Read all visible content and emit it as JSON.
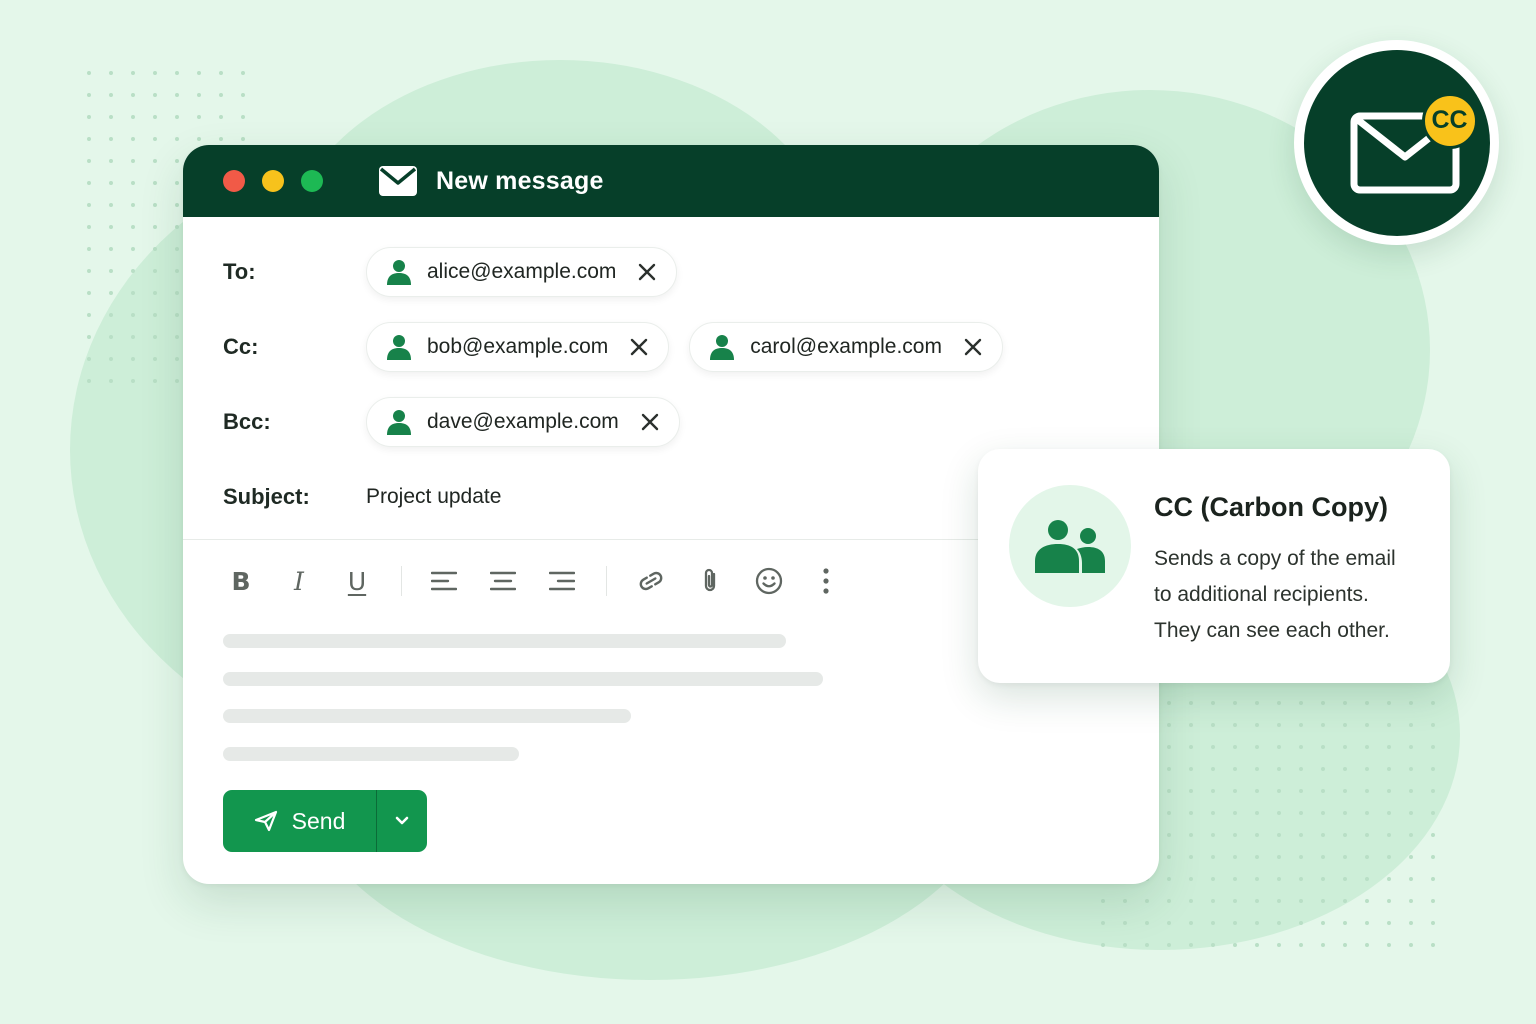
{
  "window": {
    "title": "New message",
    "traffic_lights": [
      "#f15a47",
      "#f7c21c",
      "#1db954"
    ]
  },
  "fields": {
    "to": {
      "label": "To:",
      "recipients": [
        "alice@example.com"
      ]
    },
    "cc": {
      "label": "Cc:",
      "recipients": [
        "bob@example.com",
        "carol@example.com"
      ]
    },
    "bcc": {
      "label": "Bcc:",
      "recipients": [
        "dave@example.com"
      ]
    },
    "subject": {
      "label": "Subject:",
      "value": "Project update"
    }
  },
  "toolbar": {
    "bold": "B",
    "italic": "I",
    "underline": "U",
    "icons": [
      "align-left-icon",
      "align-center-icon",
      "align-right-icon",
      "link-icon",
      "paperclip-icon",
      "emoji-icon",
      "more-vertical-icon"
    ]
  },
  "send": {
    "label": "Send"
  },
  "info_card": {
    "title": "CC (Carbon Copy)",
    "lines": [
      "Sends a copy of the email",
      "to additional recipients.",
      "They can see each other."
    ]
  },
  "badge": {
    "label": "CC"
  },
  "colors": {
    "dark_green": "#063f29",
    "accent_green": "#12964e",
    "icon_green": "#17824a",
    "badge_yellow": "#f9c21a",
    "background": "#e4f7ea"
  }
}
